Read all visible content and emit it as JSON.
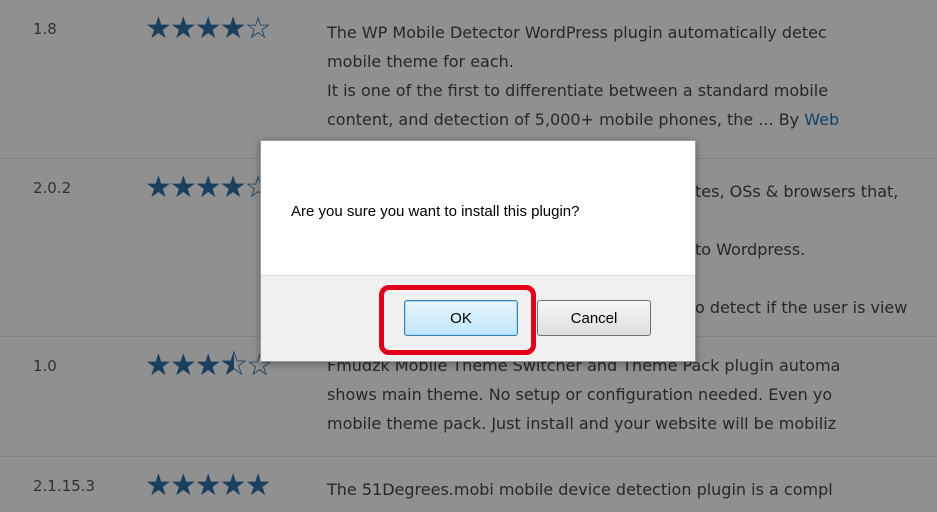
{
  "plugins": [
    {
      "version": "1.8",
      "rating_stars": 4,
      "stars_display": "★★★★☆",
      "lines": [
        "The WP Mobile Detector WordPress plugin automatically detec",
        "mobile theme for each.",
        "It is one of the first to differentiate between a standard mobile",
        "content, and detection of 5,000+ mobile phones, the ... By "
      ],
      "author_link": "Web"
    },
    {
      "version": "2.0.2",
      "rating_stars": 4,
      "stars_display": "★★★★☆",
      "lines": [
        "tes, OSs & browsers that, ",
        "",
        "to Wordpress.",
        "",
        "o detect if the user is view"
      ]
    },
    {
      "version": "1.0",
      "rating_stars": 3.5,
      "stars_display": "★★★⯪☆",
      "lines": [
        "Fmudzk Mobile Theme Switcher and Theme Pack plugin automa",
        "shows main theme. No setup or configuration needed. Even yo",
        "mobile theme pack. Just install and your website will be mobiliz"
      ]
    },
    {
      "version": "2.1.15.3",
      "rating_stars": 5,
      "stars_display": "★★★★★",
      "lines": [
        "The 51Degrees.mobi mobile device detection plugin is a compl"
      ]
    }
  ],
  "dialog": {
    "message": "Are you sure you want to install this plugin?",
    "ok_label": "OK",
    "cancel_label": "Cancel"
  },
  "colors": {
    "star": "#2e6da4",
    "highlight": "#e0001b",
    "link": "#2271b1"
  }
}
